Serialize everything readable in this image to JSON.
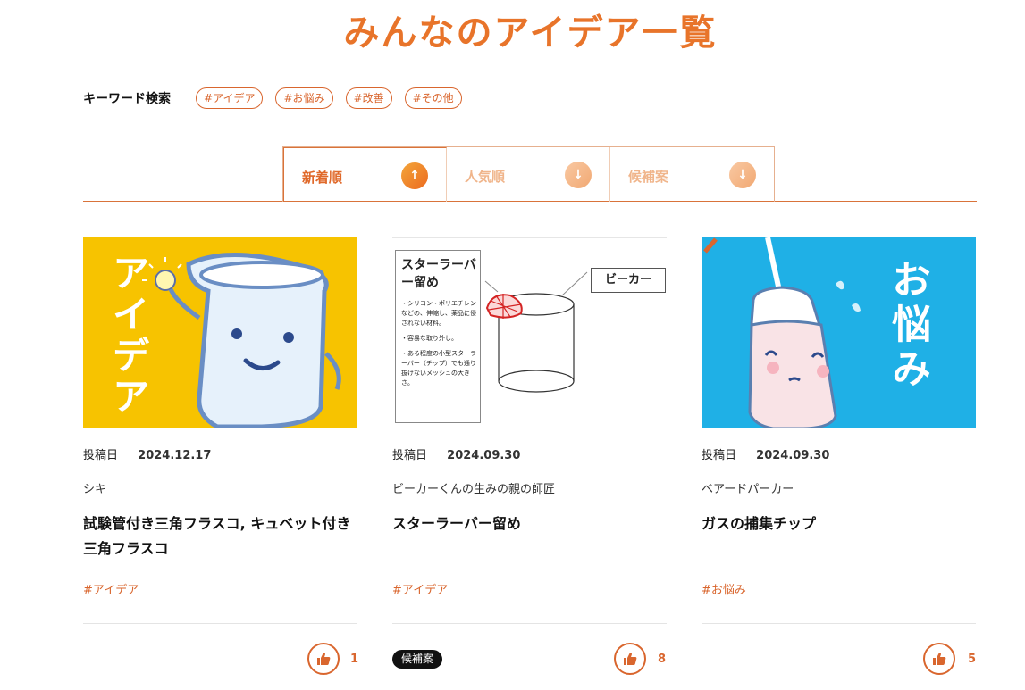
{
  "page": {
    "title": "みんなのアイデア一覧"
  },
  "keyword_search": {
    "label": "キーワード検索",
    "tags": [
      "#アイデア",
      "#お悩み",
      "#改善",
      "#その他"
    ]
  },
  "sort_tabs": [
    {
      "label": "新着順",
      "arrow": "↑",
      "active": true
    },
    {
      "label": "人気順",
      "arrow": "↓",
      "active": false
    },
    {
      "label": "候補案",
      "arrow": "↓",
      "active": false
    }
  ],
  "cards": [
    {
      "date_label": "投稿日",
      "date": "2024.12.17",
      "author": "シキ",
      "title": "試験管付き三角フラスコ, キュベット付き三角フラスコ",
      "tag": "#アイデア",
      "likes": "1",
      "badge": "",
      "image": {
        "caption": "アイデア",
        "bg": "#f7c300",
        "icon": "beaker-character-idea"
      }
    },
    {
      "date_label": "投稿日",
      "date": "2024.09.30",
      "author": "ビーカーくんの生みの親の師匠",
      "title": "スターラーバー留め",
      "tag": "#アイデア",
      "likes": "8",
      "badge": "候補案",
      "image": {
        "heading": "スターラーバー留め",
        "notes": [
          "・シリコン・ポリエチレンなどの、伸縮し、薬品に侵されない材料。",
          "・容易な取り外し。",
          "・ある程度の小型スターラーバー（チップ）でも通り抜けないメッシュの大きさ。"
        ],
        "callout": "ビーカー",
        "icon": "beaker-sketch"
      }
    },
    {
      "date_label": "投稿日",
      "date": "2024.09.30",
      "author": "ベアードパーカー",
      "title": "ガスの捕集チップ",
      "tag": "#お悩み",
      "likes": "5",
      "badge": "",
      "image": {
        "caption": "お悩み",
        "bg": "#1fb0e6",
        "icon": "pipette-character-worry"
      }
    }
  ],
  "colors": {
    "accent": "#e8742a",
    "tag": "#d9662e"
  }
}
